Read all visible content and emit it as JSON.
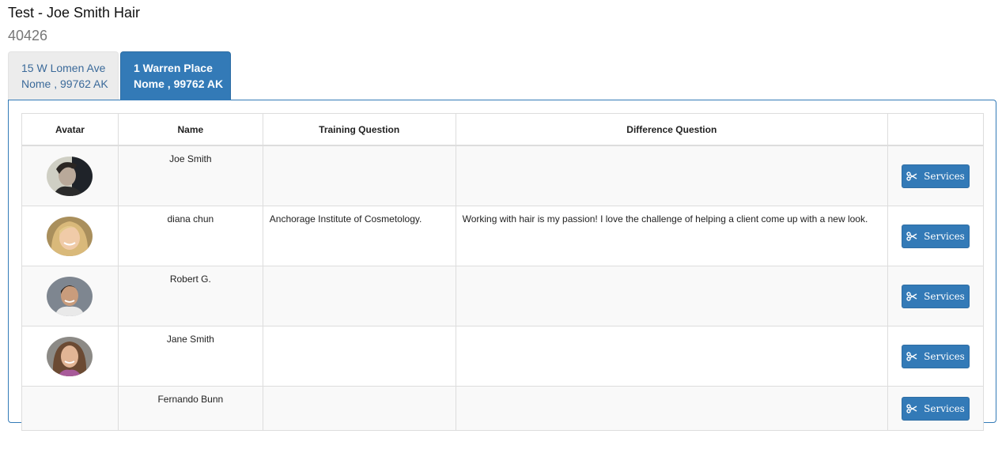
{
  "header": {
    "title": "Test - Joe Smith Hair",
    "id": "40426"
  },
  "tabs": [
    {
      "line1": "15 W Lomen Ave",
      "line2": "Nome , 99762 AK",
      "active": false
    },
    {
      "line1": "1 Warren Place",
      "line2": "Nome , 99762 AK",
      "active": true
    }
  ],
  "table": {
    "columns": [
      "Avatar",
      "Name",
      "Training Question",
      "Difference Question",
      ""
    ],
    "rows": [
      {
        "name": "Joe Smith",
        "training": "",
        "difference": "",
        "action": "Services",
        "avatar": "man-dark-hair-photo"
      },
      {
        "name": "diana chun",
        "training": "Anchorage Institute of Cosmetology.",
        "difference": "Working with hair is my passion! I love the challenge of helping a client come up with a new look.",
        "action": "Services",
        "avatar": "woman-blonde-photo"
      },
      {
        "name": "Robert G.",
        "training": "",
        "difference": "",
        "action": "Services",
        "avatar": "man-smiling-photo"
      },
      {
        "name": "Jane Smith",
        "training": "",
        "difference": "",
        "action": "Services",
        "avatar": "woman-brown-hair-photo"
      },
      {
        "name": "Fernando Bunn",
        "training": "",
        "difference": "",
        "action": "Services",
        "avatar": ""
      }
    ]
  },
  "icons": {
    "services": "scissors-icon"
  },
  "colors": {
    "primary": "#337ab7",
    "tab_inactive_bg": "#ececec",
    "row_stripe": "#f9f9f9"
  }
}
